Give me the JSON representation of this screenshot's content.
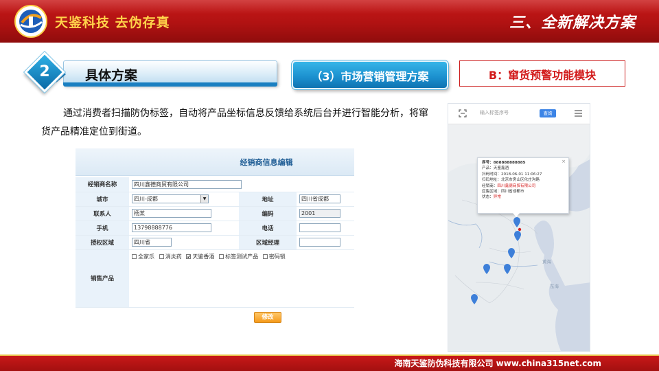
{
  "header": {
    "brand": "天鉴科技 去伪存真",
    "section_title": "三、全新解决方案",
    "colors": {
      "bar": "#b81414",
      "brand_text": "#ffd24a"
    }
  },
  "step": {
    "number": "2",
    "title": "具体方案"
  },
  "plan_label": "（3）市场营销管理方案",
  "module_label": "B：窜货预警功能模块",
  "description": "通过消费者扫描防伪标签，自动将产品坐标信息反馈给系统后台并进行智能分析，将窜货产品精准定位到街道。",
  "form": {
    "title": "经销商信息编辑",
    "rows": {
      "dealer_name": {
        "label": "经销商名称",
        "value": "四川鑫德商贸有限公司"
      },
      "city": {
        "label": "城市",
        "value": "四川-成都"
      },
      "address": {
        "label": "地址",
        "value": "四川省成都"
      },
      "contact": {
        "label": "联系人",
        "value": "杨某"
      },
      "code": {
        "label": "编码",
        "value": "2001"
      },
      "mobile": {
        "label": "手机",
        "value": "13798888776"
      },
      "phone": {
        "label": "电话",
        "value": ""
      },
      "region": {
        "label": "授权区域",
        "value": "四川省"
      },
      "region_manager": {
        "label": "区域经理",
        "value": ""
      },
      "products": {
        "label": "销售产品",
        "items": [
          {
            "name": "全家乐",
            "checked": false
          },
          {
            "name": "消炎药",
            "checked": false
          },
          {
            "name": "天鉴香酒",
            "checked": true
          },
          {
            "name": "标签测试产品",
            "checked": false
          },
          {
            "name": "密码锁",
            "checked": false
          }
        ]
      }
    },
    "submit_label": "修改"
  },
  "map": {
    "search_placeholder": "输入标签序号",
    "query_button": "查询",
    "popup": {
      "close": "×",
      "serial": "序号：888888888885",
      "product": "产品：天鉴鑫酒",
      "scan_time": "扫码时间：2018-06-01 11:06:27",
      "scan_location": "扫码地址：北京市房山区化庄沟路",
      "dealer_label": "经销商：",
      "dealer_value": "四川鑫德商贸有限公司",
      "sales_region": "应售区域：四川省成都市",
      "status_label": "状态：",
      "status_value": "异常"
    },
    "labels": {
      "sea1": "黄海",
      "sea2": "东海"
    },
    "colors": {
      "pin": "#3d7fd9",
      "alert": "#d52020"
    }
  },
  "footer": {
    "text": "海南天鉴防伪科技有限公司   www.china315net.com"
  }
}
